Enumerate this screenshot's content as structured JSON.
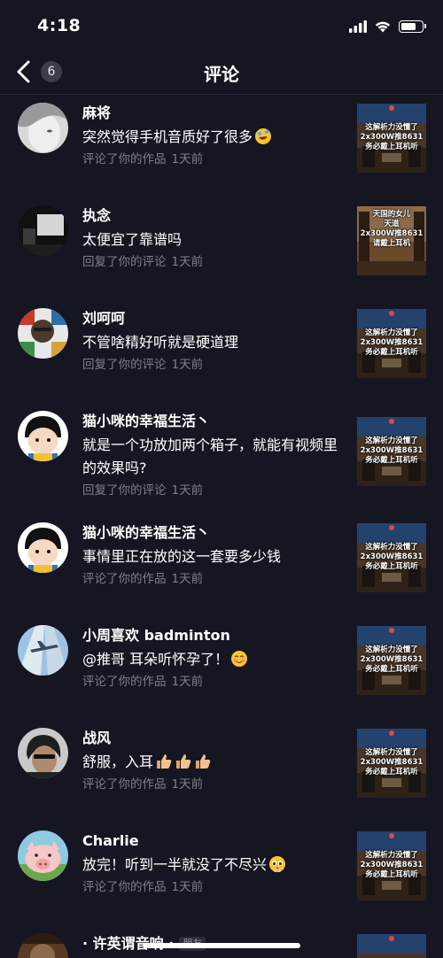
{
  "status": {
    "time": "4:18",
    "signal_icon": "signal-bars-icon",
    "wifi_icon": "wifi-icon",
    "battery_icon": "battery-icon"
  },
  "nav": {
    "title": "评论",
    "back_badge": "6",
    "back_icon": "chevron-left-icon"
  },
  "comments": [
    {
      "username": "麻将",
      "text": "突然觉得手机音质好了很多",
      "emoji": "rofl-emoji-icon",
      "action": "评论了你的作品",
      "time": "1天前",
      "thumb_caption": "这解析力没懂了\n2x300W推8631\n务必戴上耳机听"
    },
    {
      "username": "执念",
      "text": "太便宜了靠谱吗",
      "action": "回复了你的评论",
      "time": "1天前",
      "thumb_caption": "天国的女儿\n天道\n2x300W推8631\n请戴上耳机"
    },
    {
      "username": "刘呵呵",
      "text": "不管啥精好听就是硬道理",
      "action": "回复了你的评论",
      "time": "1天前",
      "thumb_caption": "这解析力没懂了\n2x300W推8631\n务必戴上耳机听"
    },
    {
      "username": "猫小咪的幸福生活丶",
      "text": "就是一个功放加两个箱子，就能有视频里的效果吗?",
      "action": "回复了你的评论",
      "time": "1天前",
      "thumb_caption": "这解析力没懂了\n2x300W推8631\n务必戴上耳机听"
    },
    {
      "username": "猫小咪的幸福生活丶",
      "text": "事情里正在放的这一套要多少钱",
      "action": "评论了你的作品",
      "time": "1天前",
      "thumb_caption": "这解析力没懂了\n2x300W推8631\n务必戴上耳机听"
    },
    {
      "username": "小周喜欢 badminton",
      "text": "@推哥 耳朵听怀孕了！",
      "emoji": "blush-emoji-icon",
      "action": "评论了你的作品",
      "time": "1天前",
      "thumb_caption": "这解析力没懂了\n2x300W推8631\n务必戴上耳机听"
    },
    {
      "username": "战风",
      "text": "舒服，入耳",
      "emoji": "thumbs-up-icon",
      "action": "评论了你的作品",
      "time": "1天前",
      "thumb_caption": "这解析力没懂了\n2x300W推8631\n务必戴上耳机听"
    },
    {
      "username": "Charlie",
      "text": "放完！听到一半就没了不尽兴",
      "emoji": "pleading-emoji-icon",
      "action": "评论了你的作品",
      "time": "1天前",
      "thumb_caption": "这解析力没懂了\n2x300W推8631\n务必戴上耳机听"
    },
    {
      "username": "· 许英谓音响 ·",
      "tag": "朋友",
      "text": "",
      "action": "",
      "time": "",
      "thumb_caption": ""
    }
  ],
  "colors": {
    "background": "#161622",
    "meta_text": "#7f7f8a",
    "divider": "#2a2a36"
  }
}
